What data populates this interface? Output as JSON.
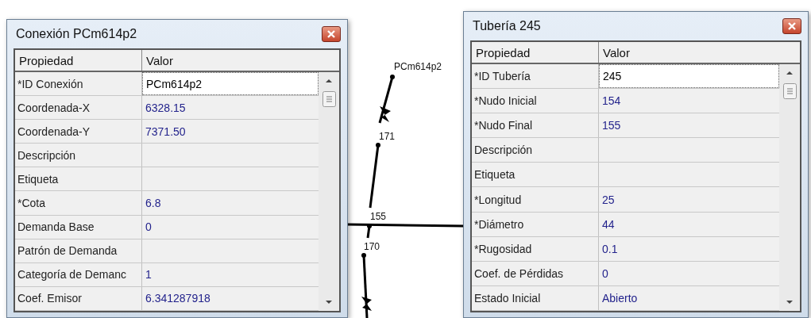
{
  "map": {
    "labels": [
      "PCm614p2",
      "171",
      "155",
      "170"
    ]
  },
  "dialogs": [
    {
      "title": "Conexión PCm614p2",
      "columns": [
        "Propiedad",
        "Valor"
      ],
      "rows": [
        {
          "name": "*ID Conexión",
          "value": "PCm614p2",
          "editing": true
        },
        {
          "name": "Coordenada-X",
          "value": "6328.15",
          "editing": false
        },
        {
          "name": "Coordenada-Y",
          "value": "7371.50",
          "editing": false
        },
        {
          "name": "Descripción",
          "editing": false
        },
        {
          "name": "Etiqueta",
          "editing": false
        },
        {
          "name": "*Cota",
          "value": "6.8",
          "editing": false
        },
        {
          "name": "Demanda Base",
          "value": "0",
          "editing": false
        },
        {
          "name": "Patrón de Demanda",
          "editing": false
        },
        {
          "name": "Categoría de Demanc",
          "value": "1",
          "editing": false
        },
        {
          "name": "Coef. Emisor",
          "value": "6.341287918",
          "editing": false
        }
      ]
    },
    {
      "title": "Tubería 245",
      "columns": [
        "Propiedad",
        "Valor"
      ],
      "rows": [
        {
          "name": "*ID Tubería",
          "value": "245",
          "editing": true
        },
        {
          "name": "*Nudo Inicial",
          "value": "154",
          "editing": false
        },
        {
          "name": "*Nudo Final",
          "value": "155",
          "editing": false
        },
        {
          "name": "Descripción",
          "editing": false
        },
        {
          "name": "Etiqueta",
          "editing": false
        },
        {
          "name": "*Longitud",
          "value": "25",
          "editing": false
        },
        {
          "name": "*Diámetro",
          "value": "44",
          "editing": false
        },
        {
          "name": "*Rugosidad",
          "value": "0.1",
          "editing": false
        },
        {
          "name": "Coef. de Pérdidas",
          "value": "0",
          "editing": false
        },
        {
          "name": "Estado Inicial",
          "value": "Abierto",
          "editing": false
        }
      ]
    }
  ]
}
